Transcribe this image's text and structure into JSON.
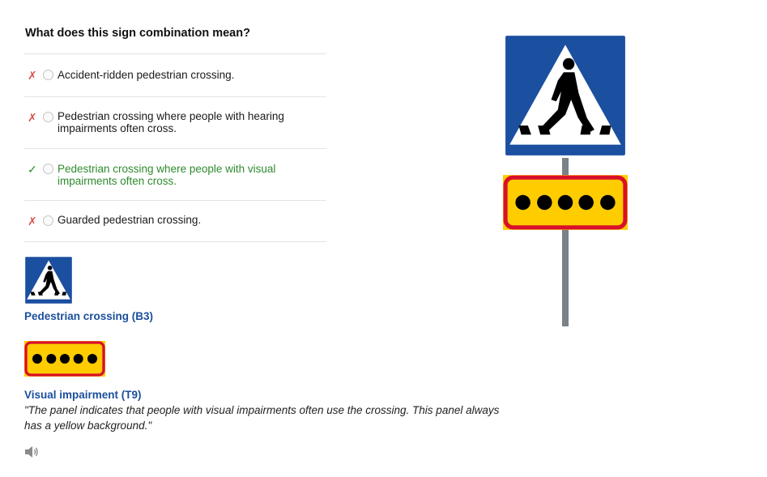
{
  "question": "What does this sign combination mean?",
  "answers": [
    {
      "mark": "✗",
      "status": "wrong",
      "text": "Accident-ridden pedestrian crossing."
    },
    {
      "mark": "✗",
      "status": "wrong",
      "text": "Pedestrian crossing where people with hearing impairments often cross."
    },
    {
      "mark": "✓",
      "status": "correct",
      "text": "Pedestrian crossing where people with visual impairments often cross."
    },
    {
      "mark": "✗",
      "status": "wrong",
      "text": "Guarded pedestrian crossing."
    }
  ],
  "signs": [
    {
      "caption": "Pedestrian crossing (B3)"
    },
    {
      "caption": "Visual impairment (T9)",
      "description": "\"The panel indicates that people with visual impairments often use the crossing. This panel always has a yellow background.\""
    }
  ],
  "colors": {
    "sign_blue": "#1b4fa0",
    "panel_yellow": "#ffcc00",
    "panel_red": "#d8102a",
    "correct_green": "#2e8b2e",
    "wrong_red": "#d9534f",
    "link_blue": "#1b4f9c"
  },
  "icons": {
    "audio": "speaker-icon",
    "wrong": "cross-icon",
    "correct": "check-icon"
  }
}
